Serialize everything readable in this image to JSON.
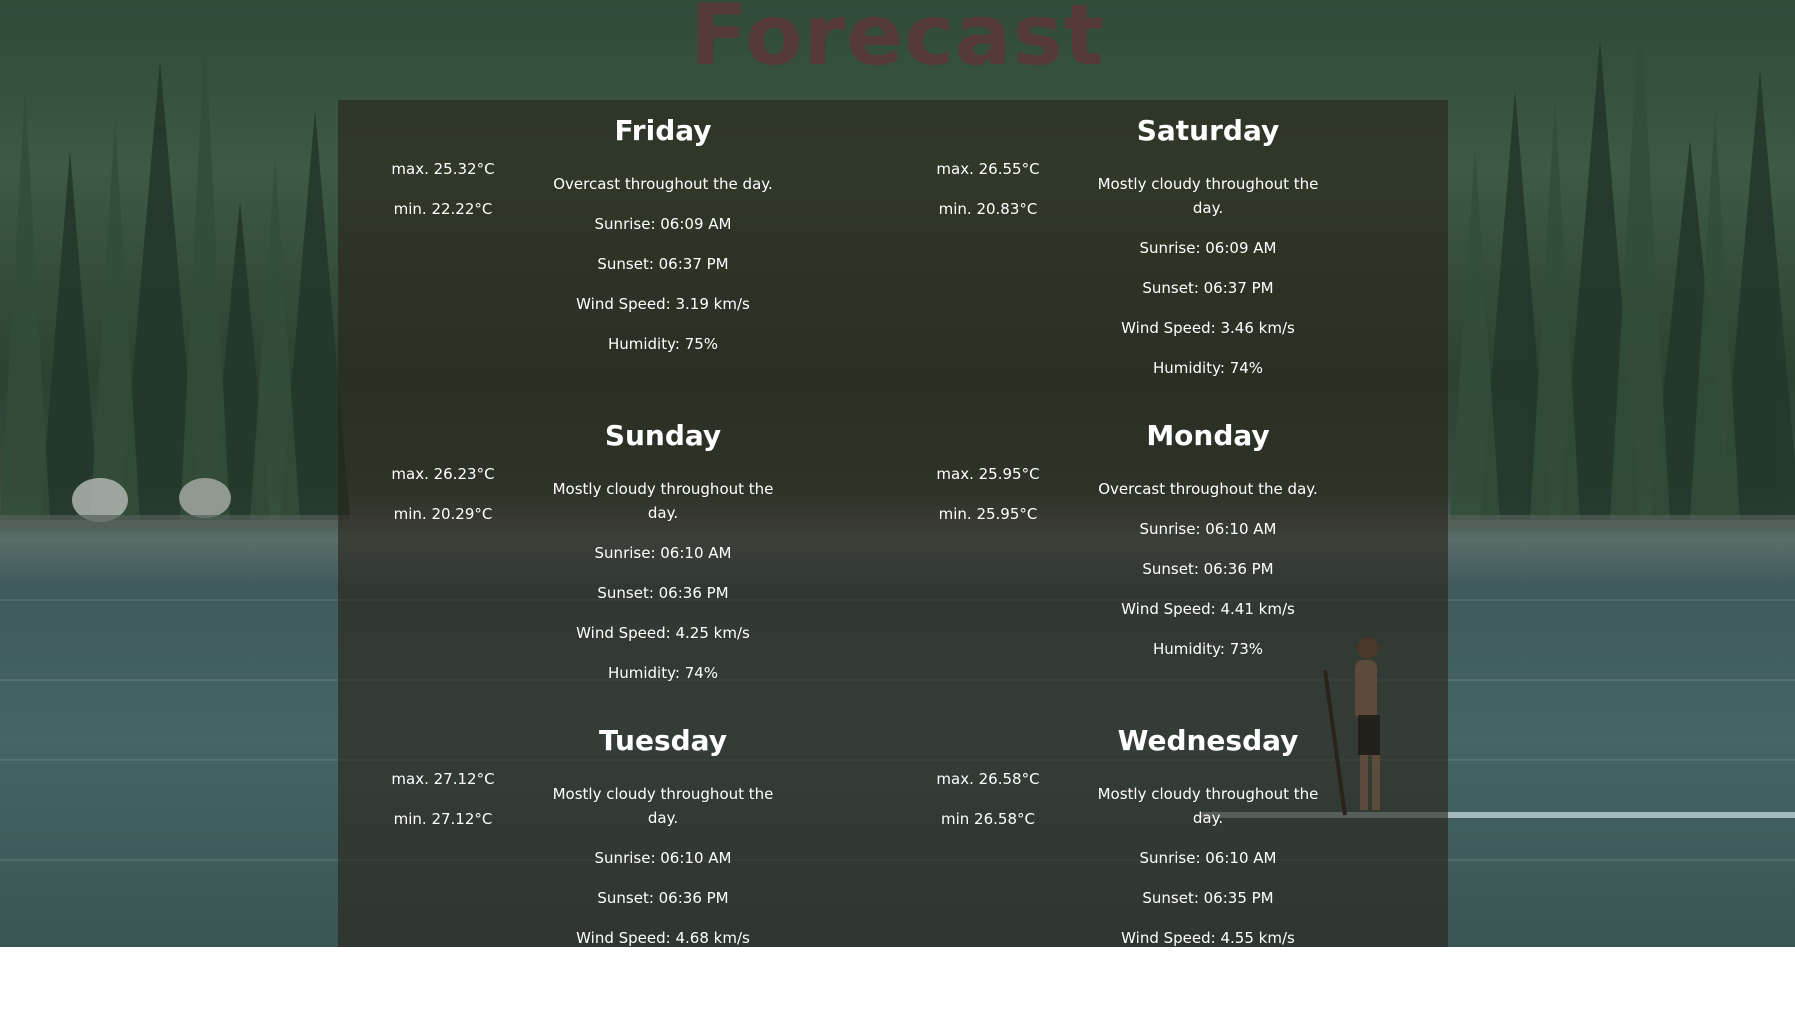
{
  "page": {
    "title": "Forecast"
  },
  "days": [
    {
      "name": "Friday",
      "max": "max. 25.32°C",
      "min": "min. 22.22°C",
      "description": "Overcast throughout the day.",
      "sunrise": "Sunrise: 06:09 AM",
      "sunset": "Sunset: 06:37 PM",
      "wind": "Wind Speed: 3.19 km/s",
      "humidity": "Humidity: 75%"
    },
    {
      "name": "Saturday",
      "max": "max. 26.55°C",
      "min": "min. 20.83°C",
      "description": "Mostly cloudy throughout the day.",
      "sunrise": "Sunrise: 06:09 AM",
      "sunset": "Sunset: 06:37 PM",
      "wind": "Wind Speed: 3.46 km/s",
      "humidity": "Humidity: 74%"
    },
    {
      "name": "Sunday",
      "max": "max. 26.23°C",
      "min": "min. 20.29°C",
      "description": "Mostly cloudy throughout the day.",
      "sunrise": "Sunrise: 06:10 AM",
      "sunset": "Sunset: 06:36 PM",
      "wind": "Wind Speed: 4.25 km/s",
      "humidity": "Humidity: 74%"
    },
    {
      "name": "Monday",
      "max": "max. 25.95°C",
      "min": "min. 25.95°C",
      "description": "Overcast throughout the day.",
      "sunrise": "Sunrise: 06:10 AM",
      "sunset": "Sunset: 06:36 PM",
      "wind": "Wind Speed: 4.41 km/s",
      "humidity": "Humidity: 73%"
    },
    {
      "name": "Tuesday",
      "max": "max. 27.12°C",
      "min": "min. 27.12°C",
      "description": "Mostly cloudy throughout the day.",
      "sunrise": "Sunrise: 06:10 AM",
      "sunset": "Sunset: 06:36 PM",
      "wind": "Wind Speed: 4.68 km/s",
      "humidity": ""
    },
    {
      "name": "Wednesday",
      "max": "max. 26.58°C",
      "min": "min 26.58°C",
      "description": "Mostly cloudy throughout the day.",
      "sunrise": "Sunrise: 06:10 AM",
      "sunset": "Sunset: 06:35 PM",
      "wind": "Wind Speed: 4.55 km/s",
      "humidity": ""
    }
  ],
  "colors": {
    "title": "#553939",
    "panel": "rgba(40,36,26,0.62)",
    "text": "#ffffff"
  }
}
